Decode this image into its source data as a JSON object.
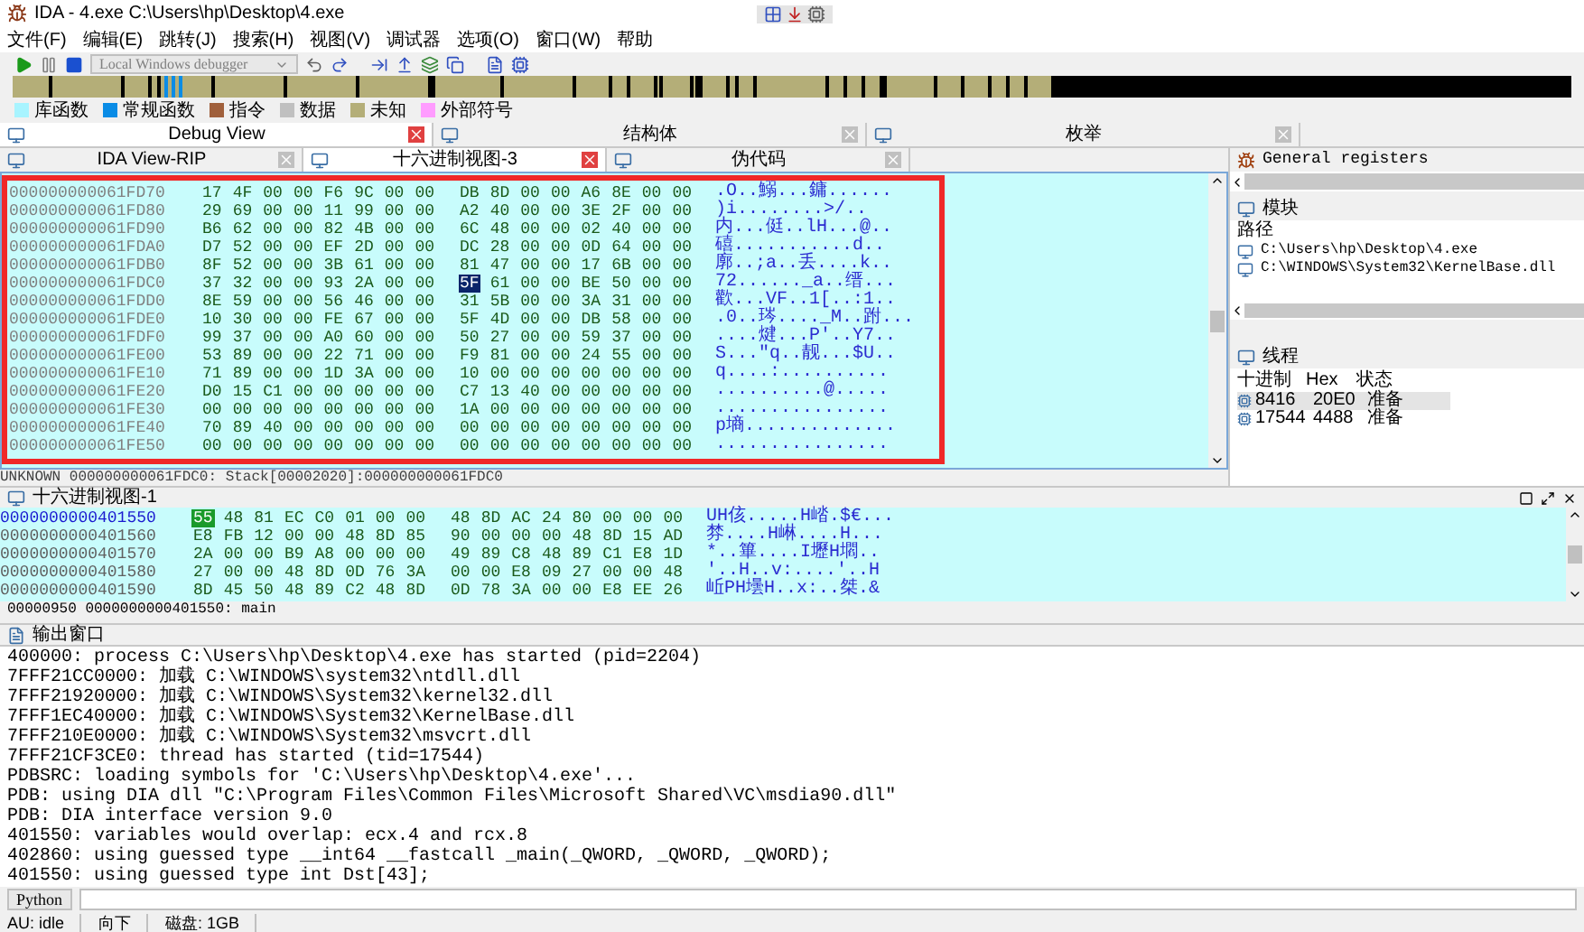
{
  "window": {
    "title": "IDA - 4.exe C:\\Users\\hp\\Desktop\\4.exe"
  },
  "menu": [
    "文件(F)",
    "编辑(E)",
    "跳转(J)",
    "搜索(H)",
    "视图(V)",
    "调试器",
    "选项(O)",
    "窗口(W)",
    "帮助"
  ],
  "toolbar": {
    "debugger": "Local Windows debugger"
  },
  "legend": [
    {
      "label": "库函数",
      "color": "#a8f4ff"
    },
    {
      "label": "常规函数",
      "color": "#0a8ce6"
    },
    {
      "label": "指令",
      "color": "#a0603c"
    },
    {
      "label": "数据",
      "color": "#c0c0c0"
    },
    {
      "label": "未知",
      "color": "#b4ae78"
    },
    {
      "label": "外部符号",
      "color": "#ff9cff"
    }
  ],
  "top_tabs": [
    {
      "label": "Debug View",
      "selected": true
    },
    {
      "label": "结构体",
      "selected": false
    },
    {
      "label": "枚举",
      "selected": false
    }
  ],
  "sub_tabs": [
    {
      "label": "IDA View-RIP",
      "selected": false
    },
    {
      "label": "十六进制视图-3",
      "selected": true
    },
    {
      "label": "伪代码",
      "selected": false
    }
  ],
  "hex_view": {
    "rows": [
      {
        "address": "000000000061FD70",
        "ascii": ".O..鰯...鏞......",
        "bytes": [
          {
            "b": "17",
            "selected": false
          },
          {
            "b": "4F",
            "selected": false
          },
          {
            "b": "00",
            "selected": false
          },
          {
            "b": "00",
            "selected": false
          },
          {
            "b": "F6",
            "selected": false
          },
          {
            "b": "9C",
            "selected": false
          },
          {
            "b": "00",
            "selected": false
          },
          {
            "b": "00",
            "selected": false
          },
          {
            "b": "DB",
            "selected": false
          },
          {
            "b": "8D",
            "selected": false
          },
          {
            "b": "00",
            "selected": false
          },
          {
            "b": "00",
            "selected": false
          },
          {
            "b": "A6",
            "selected": false
          },
          {
            "b": "8E",
            "selected": false
          },
          {
            "b": "00",
            "selected": false
          },
          {
            "b": "00",
            "selected": false
          }
        ]
      },
      {
        "address": "000000000061FD80",
        "ascii": ")i........>/..",
        "bytes": [
          {
            "b": "29",
            "selected": false
          },
          {
            "b": "69",
            "selected": false
          },
          {
            "b": "00",
            "selected": false
          },
          {
            "b": "00",
            "selected": false
          },
          {
            "b": "11",
            "selected": false
          },
          {
            "b": "99",
            "selected": false
          },
          {
            "b": "00",
            "selected": false
          },
          {
            "b": "00",
            "selected": false
          },
          {
            "b": "A2",
            "selected": false
          },
          {
            "b": "40",
            "selected": false
          },
          {
            "b": "00",
            "selected": false
          },
          {
            "b": "00",
            "selected": false
          },
          {
            "b": "3E",
            "selected": false
          },
          {
            "b": "2F",
            "selected": false
          },
          {
            "b": "00",
            "selected": false
          },
          {
            "b": "00",
            "selected": false
          }
        ]
      },
      {
        "address": "000000000061FD90",
        "ascii": "内...侹..lH...@..",
        "bytes": [
          {
            "b": "B6",
            "selected": false
          },
          {
            "b": "62",
            "selected": false
          },
          {
            "b": "00",
            "selected": false
          },
          {
            "b": "00",
            "selected": false
          },
          {
            "b": "82",
            "selected": false
          },
          {
            "b": "4B",
            "selected": false
          },
          {
            "b": "00",
            "selected": false
          },
          {
            "b": "00",
            "selected": false
          },
          {
            "b": "6C",
            "selected": false
          },
          {
            "b": "48",
            "selected": false
          },
          {
            "b": "00",
            "selected": false
          },
          {
            "b": "00",
            "selected": false
          },
          {
            "b": "02",
            "selected": false
          },
          {
            "b": "40",
            "selected": false
          },
          {
            "b": "00",
            "selected": false
          },
          {
            "b": "00",
            "selected": false
          }
        ]
      },
      {
        "address": "000000000061FDA0",
        "ascii": "礂...........d..",
        "bytes": [
          {
            "b": "D7",
            "selected": false
          },
          {
            "b": "52",
            "selected": false
          },
          {
            "b": "00",
            "selected": false
          },
          {
            "b": "00",
            "selected": false
          },
          {
            "b": "EF",
            "selected": false
          },
          {
            "b": "2D",
            "selected": false
          },
          {
            "b": "00",
            "selected": false
          },
          {
            "b": "00",
            "selected": false
          },
          {
            "b": "DC",
            "selected": false
          },
          {
            "b": "28",
            "selected": false
          },
          {
            "b": "00",
            "selected": false
          },
          {
            "b": "00",
            "selected": false
          },
          {
            "b": "0D",
            "selected": false
          },
          {
            "b": "64",
            "selected": false
          },
          {
            "b": "00",
            "selected": false
          },
          {
            "b": "00",
            "selected": false
          }
        ]
      },
      {
        "address": "000000000061FDB0",
        "ascii": "廓..;a..丢....k..",
        "bytes": [
          {
            "b": "8F",
            "selected": false
          },
          {
            "b": "52",
            "selected": false
          },
          {
            "b": "00",
            "selected": false
          },
          {
            "b": "00",
            "selected": false
          },
          {
            "b": "3B",
            "selected": false
          },
          {
            "b": "61",
            "selected": false
          },
          {
            "b": "00",
            "selected": false
          },
          {
            "b": "00",
            "selected": false
          },
          {
            "b": "81",
            "selected": false
          },
          {
            "b": "47",
            "selected": false
          },
          {
            "b": "00",
            "selected": false
          },
          {
            "b": "00",
            "selected": false
          },
          {
            "b": "17",
            "selected": false
          },
          {
            "b": "6B",
            "selected": false
          },
          {
            "b": "00",
            "selected": false
          },
          {
            "b": "00",
            "selected": false
          }
        ]
      },
      {
        "address": "000000000061FDC0",
        "ascii": "72......_a..缙...",
        "bytes": [
          {
            "b": "37",
            "selected": false
          },
          {
            "b": "32",
            "selected": false
          },
          {
            "b": "00",
            "selected": false
          },
          {
            "b": "00",
            "selected": false
          },
          {
            "b": "93",
            "selected": false
          },
          {
            "b": "2A",
            "selected": false
          },
          {
            "b": "00",
            "selected": false
          },
          {
            "b": "00",
            "selected": false
          },
          {
            "b": "5F",
            "selected": true
          },
          {
            "b": "61",
            "selected": false
          },
          {
            "b": "00",
            "selected": false
          },
          {
            "b": "00",
            "selected": false
          },
          {
            "b": "BE",
            "selected": false
          },
          {
            "b": "50",
            "selected": false
          },
          {
            "b": "00",
            "selected": false
          },
          {
            "b": "00",
            "selected": false
          }
        ]
      },
      {
        "address": "000000000061FDD0",
        "ascii": "歡...VF..1[..:1..",
        "bytes": [
          {
            "b": "8E",
            "selected": false
          },
          {
            "b": "59",
            "selected": false
          },
          {
            "b": "00",
            "selected": false
          },
          {
            "b": "00",
            "selected": false
          },
          {
            "b": "56",
            "selected": false
          },
          {
            "b": "46",
            "selected": false
          },
          {
            "b": "00",
            "selected": false
          },
          {
            "b": "00",
            "selected": false
          },
          {
            "b": "31",
            "selected": false
          },
          {
            "b": "5B",
            "selected": false
          },
          {
            "b": "00",
            "selected": false
          },
          {
            "b": "00",
            "selected": false
          },
          {
            "b": "3A",
            "selected": false
          },
          {
            "b": "31",
            "selected": false
          },
          {
            "b": "00",
            "selected": false
          },
          {
            "b": "00",
            "selected": false
          }
        ]
      },
      {
        "address": "000000000061FDE0",
        "ascii": ".0..琌...._M..跗...",
        "bytes": [
          {
            "b": "10",
            "selected": false
          },
          {
            "b": "30",
            "selected": false
          },
          {
            "b": "00",
            "selected": false
          },
          {
            "b": "00",
            "selected": false
          },
          {
            "b": "FE",
            "selected": false
          },
          {
            "b": "67",
            "selected": false
          },
          {
            "b": "00",
            "selected": false
          },
          {
            "b": "00",
            "selected": false
          },
          {
            "b": "5F",
            "selected": false
          },
          {
            "b": "4D",
            "selected": false
          },
          {
            "b": "00",
            "selected": false
          },
          {
            "b": "00",
            "selected": false
          },
          {
            "b": "DB",
            "selected": false
          },
          {
            "b": "58",
            "selected": false
          },
          {
            "b": "00",
            "selected": false
          },
          {
            "b": "00",
            "selected": false
          }
        ]
      },
      {
        "address": "000000000061FDF0",
        "ascii": "....煡...P'..Y7..",
        "bytes": [
          {
            "b": "99",
            "selected": false
          },
          {
            "b": "37",
            "selected": false
          },
          {
            "b": "00",
            "selected": false
          },
          {
            "b": "00",
            "selected": false
          },
          {
            "b": "A0",
            "selected": false
          },
          {
            "b": "60",
            "selected": false
          },
          {
            "b": "00",
            "selected": false
          },
          {
            "b": "00",
            "selected": false
          },
          {
            "b": "50",
            "selected": false
          },
          {
            "b": "27",
            "selected": false
          },
          {
            "b": "00",
            "selected": false
          },
          {
            "b": "00",
            "selected": false
          },
          {
            "b": "59",
            "selected": false
          },
          {
            "b": "37",
            "selected": false
          },
          {
            "b": "00",
            "selected": false
          },
          {
            "b": "00",
            "selected": false
          }
        ]
      },
      {
        "address": "000000000061FE00",
        "ascii": "S...\"q..靓...$U..",
        "bytes": [
          {
            "b": "53",
            "selected": false
          },
          {
            "b": "89",
            "selected": false
          },
          {
            "b": "00",
            "selected": false
          },
          {
            "b": "00",
            "selected": false
          },
          {
            "b": "22",
            "selected": false
          },
          {
            "b": "71",
            "selected": false
          },
          {
            "b": "00",
            "selected": false
          },
          {
            "b": "00",
            "selected": false
          },
          {
            "b": "F9",
            "selected": false
          },
          {
            "b": "81",
            "selected": false
          },
          {
            "b": "00",
            "selected": false
          },
          {
            "b": "00",
            "selected": false
          },
          {
            "b": "24",
            "selected": false
          },
          {
            "b": "55",
            "selected": false
          },
          {
            "b": "00",
            "selected": false
          },
          {
            "b": "00",
            "selected": false
          }
        ]
      },
      {
        "address": "000000000061FE10",
        "ascii": "q....:..........",
        "bytes": [
          {
            "b": "71",
            "selected": false
          },
          {
            "b": "89",
            "selected": false
          },
          {
            "b": "00",
            "selected": false
          },
          {
            "b": "00",
            "selected": false
          },
          {
            "b": "1D",
            "selected": false
          },
          {
            "b": "3A",
            "selected": false
          },
          {
            "b": "00",
            "selected": false
          },
          {
            "b": "00",
            "selected": false
          },
          {
            "b": "10",
            "selected": false
          },
          {
            "b": "00",
            "selected": false
          },
          {
            "b": "00",
            "selected": false
          },
          {
            "b": "00",
            "selected": false
          },
          {
            "b": "00",
            "selected": false
          },
          {
            "b": "00",
            "selected": false
          },
          {
            "b": "00",
            "selected": false
          },
          {
            "b": "00",
            "selected": false
          }
        ]
      },
      {
        "address": "000000000061FE20",
        "ascii": "..........@.....",
        "bytes": [
          {
            "b": "D0",
            "selected": false
          },
          {
            "b": "15",
            "selected": false
          },
          {
            "b": "C1",
            "selected": false
          },
          {
            "b": "00",
            "selected": false
          },
          {
            "b": "00",
            "selected": false
          },
          {
            "b": "00",
            "selected": false
          },
          {
            "b": "00",
            "selected": false
          },
          {
            "b": "00",
            "selected": false
          },
          {
            "b": "C7",
            "selected": false
          },
          {
            "b": "13",
            "selected": false
          },
          {
            "b": "40",
            "selected": false
          },
          {
            "b": "00",
            "selected": false
          },
          {
            "b": "00",
            "selected": false
          },
          {
            "b": "00",
            "selected": false
          },
          {
            "b": "00",
            "selected": false
          },
          {
            "b": "00",
            "selected": false
          }
        ]
      },
      {
        "address": "000000000061FE30",
        "ascii": "................",
        "bytes": [
          {
            "b": "00",
            "selected": false
          },
          {
            "b": "00",
            "selected": false
          },
          {
            "b": "00",
            "selected": false
          },
          {
            "b": "00",
            "selected": false
          },
          {
            "b": "00",
            "selected": false
          },
          {
            "b": "00",
            "selected": false
          },
          {
            "b": "00",
            "selected": false
          },
          {
            "b": "00",
            "selected": false
          },
          {
            "b": "1A",
            "selected": false
          },
          {
            "b": "00",
            "selected": false
          },
          {
            "b": "00",
            "selected": false
          },
          {
            "b": "00",
            "selected": false
          },
          {
            "b": "00",
            "selected": false
          },
          {
            "b": "00",
            "selected": false
          },
          {
            "b": "00",
            "selected": false
          },
          {
            "b": "00",
            "selected": false
          }
        ]
      },
      {
        "address": "000000000061FE40",
        "ascii": "p墒..............",
        "bytes": [
          {
            "b": "70",
            "selected": false
          },
          {
            "b": "89",
            "selected": false
          },
          {
            "b": "40",
            "selected": false
          },
          {
            "b": "00",
            "selected": false
          },
          {
            "b": "00",
            "selected": false
          },
          {
            "b": "00",
            "selected": false
          },
          {
            "b": "00",
            "selected": false
          },
          {
            "b": "00",
            "selected": false
          },
          {
            "b": "00",
            "selected": false
          },
          {
            "b": "00",
            "selected": false
          },
          {
            "b": "00",
            "selected": false
          },
          {
            "b": "00",
            "selected": false
          },
          {
            "b": "00",
            "selected": false
          },
          {
            "b": "00",
            "selected": false
          },
          {
            "b": "00",
            "selected": false
          },
          {
            "b": "00",
            "selected": false
          }
        ]
      },
      {
        "address": "000000000061FE50",
        "ascii": "................",
        "bytes": [
          {
            "b": "00",
            "selected": false
          },
          {
            "b": "00",
            "selected": false
          },
          {
            "b": "00",
            "selected": false
          },
          {
            "b": "00",
            "selected": false
          },
          {
            "b": "00",
            "selected": false
          },
          {
            "b": "00",
            "selected": false
          },
          {
            "b": "00",
            "selected": false
          },
          {
            "b": "00",
            "selected": false
          },
          {
            "b": "00",
            "selected": false
          },
          {
            "b": "00",
            "selected": false
          },
          {
            "b": "00",
            "selected": false
          },
          {
            "b": "00",
            "selected": false
          },
          {
            "b": "00",
            "selected": false
          },
          {
            "b": "00",
            "selected": false
          },
          {
            "b": "00",
            "selected": false
          },
          {
            "b": "00",
            "selected": false
          }
        ]
      }
    ],
    "status": "UNKNOWN 000000000061FDC0: Stack[00002020]:000000000061FDC0"
  },
  "registers": {
    "title": "General registers"
  },
  "modules": {
    "title": "模块",
    "column": "路径",
    "items": [
      "C:\\Users\\hp\\Desktop\\4.exe",
      "C:\\WINDOWS\\System32\\KernelBase.dll"
    ]
  },
  "threads": {
    "title": "线程",
    "columns": [
      "十进制",
      "Hex",
      "状态"
    ],
    "rows": [
      {
        "cells": [
          "8416",
          "20E0",
          "准备"
        ],
        "selected": true
      },
      {
        "cells": [
          "17544",
          "4488",
          "准备"
        ],
        "selected": false
      }
    ]
  },
  "hex_view_1": {
    "title": "十六进制视图-1",
    "rows": [
      {
        "address": "0000000000401550",
        "current": true,
        "ascii": "UH侅.....H崉.$€...",
        "bytes": [
          {
            "b": "55",
            "selected": true
          },
          {
            "b": "48",
            "selected": false
          },
          {
            "b": "81",
            "selected": false
          },
          {
            "b": "EC",
            "selected": false
          },
          {
            "b": "C0",
            "selected": false
          },
          {
            "b": "01",
            "selected": false
          },
          {
            "b": "00",
            "selected": false
          },
          {
            "b": "00",
            "selected": false
          },
          {
            "b": "48",
            "selected": false
          },
          {
            "b": "8D",
            "selected": false
          },
          {
            "b": "AC",
            "selected": false
          },
          {
            "b": "24",
            "selected": false
          },
          {
            "b": "80",
            "selected": false
          },
          {
            "b": "00",
            "selected": false
          },
          {
            "b": "00",
            "selected": false
          },
          {
            "b": "00",
            "selected": false
          }
        ]
      },
      {
        "address": "0000000000401560",
        "current": false,
        "ascii": "棼....H崊....H...",
        "bytes": [
          {
            "b": "E8",
            "selected": false
          },
          {
            "b": "FB",
            "selected": false
          },
          {
            "b": "12",
            "selected": false
          },
          {
            "b": "00",
            "selected": false
          },
          {
            "b": "00",
            "selected": false
          },
          {
            "b": "48",
            "selected": false
          },
          {
            "b": "8D",
            "selected": false
          },
          {
            "b": "85",
            "selected": false
          },
          {
            "b": "90",
            "selected": false
          },
          {
            "b": "00",
            "selected": false
          },
          {
            "b": "00",
            "selected": false
          },
          {
            "b": "00",
            "selected": false
          },
          {
            "b": "48",
            "selected": false
          },
          {
            "b": "8D",
            "selected": false
          },
          {
            "b": "15",
            "selected": false
          },
          {
            "b": "AD",
            "selected": false
          }
        ]
      },
      {
        "address": "0000000000401570",
        "current": false,
        "ascii": "*..篳....I壢H壛..",
        "bytes": [
          {
            "b": "2A",
            "selected": false
          },
          {
            "b": "00",
            "selected": false
          },
          {
            "b": "00",
            "selected": false
          },
          {
            "b": "B9",
            "selected": false
          },
          {
            "b": "A8",
            "selected": false
          },
          {
            "b": "00",
            "selected": false
          },
          {
            "b": "00",
            "selected": false
          },
          {
            "b": "00",
            "selected": false
          },
          {
            "b": "49",
            "selected": false
          },
          {
            "b": "89",
            "selected": false
          },
          {
            "b": "C8",
            "selected": false
          },
          {
            "b": "48",
            "selected": false
          },
          {
            "b": "89",
            "selected": false
          },
          {
            "b": "C1",
            "selected": false
          },
          {
            "b": "E8",
            "selected": false
          },
          {
            "b": "1D",
            "selected": false
          }
        ]
      },
      {
        "address": "0000000000401580",
        "current": false,
        "ascii": "'..H..v:....'..H",
        "bytes": [
          {
            "b": "27",
            "selected": false
          },
          {
            "b": "00",
            "selected": false
          },
          {
            "b": "00",
            "selected": false
          },
          {
            "b": "48",
            "selected": false
          },
          {
            "b": "8D",
            "selected": false
          },
          {
            "b": "0D",
            "selected": false
          },
          {
            "b": "76",
            "selected": false
          },
          {
            "b": "3A",
            "selected": false
          },
          {
            "b": "00",
            "selected": false
          },
          {
            "b": "00",
            "selected": false
          },
          {
            "b": "E8",
            "selected": false
          },
          {
            "b": "09",
            "selected": false
          },
          {
            "b": "27",
            "selected": false
          },
          {
            "b": "00",
            "selected": false
          },
          {
            "b": "00",
            "selected": false
          },
          {
            "b": "48",
            "selected": false
          }
        ]
      },
      {
        "address": "0000000000401590",
        "current": false,
        "ascii": "岴PH壜H..x:..桀.&",
        "bytes": [
          {
            "b": "8D",
            "selected": false
          },
          {
            "b": "45",
            "selected": false
          },
          {
            "b": "50",
            "selected": false
          },
          {
            "b": "48",
            "selected": false
          },
          {
            "b": "89",
            "selected": false
          },
          {
            "b": "C2",
            "selected": false
          },
          {
            "b": "48",
            "selected": false
          },
          {
            "b": "8D",
            "selected": false
          },
          {
            "b": "0D",
            "selected": false
          },
          {
            "b": "78",
            "selected": false
          },
          {
            "b": "3A",
            "selected": false
          },
          {
            "b": "00",
            "selected": false
          },
          {
            "b": "00",
            "selected": false
          },
          {
            "b": "E8",
            "selected": false
          },
          {
            "b": "EE",
            "selected": false
          },
          {
            "b": "26",
            "selected": false
          }
        ]
      }
    ],
    "status": "00000950 0000000000401550: main"
  },
  "output": {
    "title": "输出窗口",
    "lines": [
      "400000: process C:\\Users\\hp\\Desktop\\4.exe has started (pid=2204)",
      "7FFF21CC0000: 加载 C:\\WINDOWS\\system32\\ntdll.dll",
      "7FFF21920000: 加载 C:\\WINDOWS\\System32\\kernel32.dll",
      "7FFF1EC40000: 加载 C:\\WINDOWS\\System32\\KernelBase.dll",
      "7FFF210E0000: 加载 C:\\WINDOWS\\System32\\msvcrt.dll",
      "7FFF21CF3CE0: thread has started (tid=17544)",
      "PDBSRC: loading symbols for 'C:\\Users\\hp\\Desktop\\4.exe'...",
      "PDB: using DIA dll \"C:\\Program Files\\Common Files\\Microsoft Shared\\VC\\msdia90.dll\"",
      "PDB: DIA interface version 9.0",
      "401550: variables would overlap: ecx.4 and rcx.8",
      "402860: using guessed type __int64 __fastcall _main(_QWORD, _QWORD, _QWORD);",
      "401550: using guessed type int Dst[43];"
    ]
  },
  "python": {
    "button": "Python"
  },
  "status_bar": [
    "AU: idle",
    "向下",
    "磁盘: 1GB"
  ]
}
